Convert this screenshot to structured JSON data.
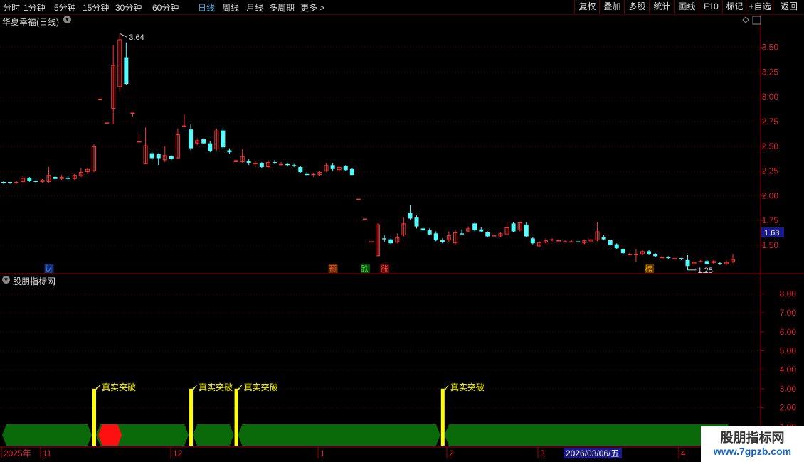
{
  "toolbar": {
    "periods": [
      "分时",
      "1分钟",
      "5分钟",
      "15分钟",
      "30分钟",
      "60分钟",
      "日线",
      "周线",
      "月线",
      "多周期",
      "更多 >"
    ],
    "active_period": "日线",
    "right_buttons": [
      "复权",
      "叠加",
      "多股",
      "统计",
      "画线",
      "F10",
      "标记",
      "+自选",
      "返回"
    ]
  },
  "main_chart": {
    "title": "华夏幸福(日线)",
    "y_ticks": [
      "3.50",
      "3.25",
      "3.00",
      "2.75",
      "2.50",
      "2.25",
      "2.00",
      "1.75",
      "1.50"
    ],
    "price_tag": "1.63",
    "high_label": "3.64",
    "low_label": "1.25",
    "event_markers": [
      {
        "text": "财",
        "color": "#3f8ff0",
        "bg": "#1a2a6a"
      },
      {
        "text": "预",
        "color": "#ff5040",
        "bg": "#5a3000"
      },
      {
        "text": "跌",
        "color": "#40e040",
        "bg": "#0a4a0a"
      },
      {
        "text": "涨",
        "color": "#ff5040",
        "bg": "#5a0a0a"
      },
      {
        "text": "榜",
        "color": "#ffb000",
        "bg": "#5a3a00"
      }
    ]
  },
  "indicator_panel": {
    "title": "股朋指标网",
    "y_ticks": [
      "8.00",
      "7.00",
      "6.00",
      "5.00",
      "4.00",
      "3.00",
      "2.00",
      "1.00"
    ],
    "signal_label": "真实突破",
    "signal_count": 4
  },
  "x_axis": {
    "labels": [
      "2025年",
      "11",
      "12",
      "1",
      "2",
      "3",
      "4"
    ],
    "date_box": "2026/03/06/五"
  },
  "watermark": {
    "line1": "股朋指标网",
    "line2": "www.7gpzb.com"
  },
  "colors": {
    "up": "#ff3232",
    "down": "#54fcfc",
    "axis": "#a00000",
    "band_green": "#0a6a0a",
    "band_red": "#ff1010",
    "signal_bar": "#ffff00",
    "price_tag_bg": "#1a1a8a"
  },
  "chart_data": {
    "type": "candlestick",
    "ylim": [
      1.22,
      3.72
    ],
    "candles": [
      [
        2.14,
        2.13,
        2.15,
        2.12
      ],
      [
        2.14,
        2.13,
        2.14,
        2.12
      ],
      [
        2.13,
        2.14,
        2.15,
        2.12
      ],
      [
        2.14,
        2.18,
        2.2,
        2.13
      ],
      [
        2.18,
        2.15,
        2.19,
        2.14
      ],
      [
        2.15,
        2.14,
        2.16,
        2.13
      ],
      [
        2.14,
        2.16,
        2.17,
        2.13
      ],
      [
        2.14,
        2.21,
        2.29,
        2.13
      ],
      [
        2.19,
        2.17,
        2.22,
        2.16
      ],
      [
        2.17,
        2.19,
        2.21,
        2.16
      ],
      [
        2.18,
        2.17,
        2.2,
        2.16
      ],
      [
        2.17,
        2.21,
        2.22,
        2.16
      ],
      [
        2.2,
        2.24,
        2.28,
        2.19
      ],
      [
        2.24,
        2.27,
        2.28,
        2.22
      ],
      [
        2.25,
        2.5,
        2.52,
        2.24
      ],
      [
        2.98,
        2.98,
        2.98,
        2.98
      ],
      [
        2.74,
        2.74,
        2.74,
        2.74
      ],
      [
        2.88,
        3.32,
        3.52,
        2.72
      ],
      [
        3.1,
        3.58,
        3.64,
        3.05
      ],
      [
        3.4,
        3.13,
        3.55,
        3.12
      ],
      [
        2.84,
        2.84,
        2.84,
        2.8
      ],
      [
        2.55,
        2.55,
        2.62,
        2.55
      ],
      [
        2.32,
        2.51,
        2.69,
        2.32
      ],
      [
        2.43,
        2.38,
        2.44,
        2.36
      ],
      [
        2.42,
        2.38,
        2.43,
        2.31
      ],
      [
        2.36,
        2.41,
        2.5,
        2.34
      ],
      [
        2.4,
        2.37,
        2.41,
        2.36
      ],
      [
        2.38,
        2.62,
        2.68,
        2.37
      ],
      [
        2.7,
        2.71,
        2.82,
        2.69
      ],
      [
        2.67,
        2.48,
        2.72,
        2.46
      ],
      [
        2.53,
        2.56,
        2.58,
        2.51
      ],
      [
        2.57,
        2.53,
        2.58,
        2.52
      ],
      [
        2.53,
        2.45,
        2.55,
        2.44
      ],
      [
        2.47,
        2.66,
        2.68,
        2.46
      ],
      [
        2.66,
        2.49,
        2.69,
        2.47
      ],
      [
        2.46,
        2.44,
        2.48,
        2.42
      ],
      [
        2.34,
        2.36,
        2.36,
        2.33
      ],
      [
        2.34,
        2.4,
        2.47,
        2.33
      ],
      [
        2.35,
        2.33,
        2.37,
        2.31
      ],
      [
        2.33,
        2.33,
        2.35,
        2.29
      ],
      [
        2.33,
        2.29,
        2.34,
        2.28
      ],
      [
        2.29,
        2.34,
        2.36,
        2.28
      ],
      [
        2.34,
        2.33,
        2.36,
        2.32
      ],
      [
        2.32,
        2.32,
        2.34,
        2.31
      ],
      [
        2.32,
        2.31,
        2.33,
        2.3
      ],
      [
        2.31,
        2.3,
        2.32,
        2.29
      ],
      [
        2.29,
        2.24,
        2.3,
        2.23
      ],
      [
        2.22,
        2.21,
        2.24,
        2.2
      ],
      [
        2.21,
        2.22,
        2.23,
        2.19
      ],
      [
        2.21,
        2.24,
        2.25,
        2.2
      ],
      [
        2.25,
        2.31,
        2.33,
        2.24
      ],
      [
        2.31,
        2.27,
        2.33,
        2.25
      ],
      [
        2.26,
        2.29,
        2.31,
        2.24
      ],
      [
        2.3,
        2.26,
        2.31,
        2.25
      ],
      [
        2.27,
        2.21,
        2.28,
        2.21
      ],
      [
        1.97,
        1.97,
        1.97,
        1.97
      ],
      [
        1.77,
        1.77,
        1.77,
        1.77
      ],
      [
        1.54,
        1.54,
        1.54,
        1.54
      ],
      [
        1.39,
        1.71,
        1.72,
        1.39
      ],
      [
        1.57,
        1.56,
        1.6,
        1.53
      ],
      [
        1.56,
        1.52,
        1.57,
        1.51
      ],
      [
        1.53,
        1.58,
        1.62,
        1.52
      ],
      [
        1.6,
        1.72,
        1.78,
        1.59
      ],
      [
        1.83,
        1.77,
        1.91,
        1.76
      ],
      [
        1.78,
        1.69,
        1.8,
        1.67
      ],
      [
        1.67,
        1.65,
        1.69,
        1.64
      ],
      [
        1.65,
        1.61,
        1.67,
        1.6
      ],
      [
        1.62,
        1.55,
        1.64,
        1.54
      ],
      [
        1.55,
        1.53,
        1.57,
        1.52
      ],
      [
        1.55,
        1.6,
        1.64,
        1.53
      ],
      [
        1.52,
        1.63,
        1.65,
        1.51
      ],
      [
        1.62,
        1.61,
        1.66,
        1.6
      ],
      [
        1.64,
        1.67,
        1.69,
        1.63
      ],
      [
        1.72,
        1.65,
        1.73,
        1.64
      ],
      [
        1.66,
        1.64,
        1.68,
        1.63
      ],
      [
        1.63,
        1.59,
        1.64,
        1.58
      ],
      [
        1.6,
        1.6,
        1.61,
        1.59
      ],
      [
        1.59,
        1.62,
        1.63,
        1.58
      ],
      [
        1.61,
        1.68,
        1.73,
        1.6
      ],
      [
        1.72,
        1.64,
        1.73,
        1.63
      ],
      [
        1.65,
        1.73,
        1.74,
        1.64
      ],
      [
        1.71,
        1.59,
        1.73,
        1.58
      ],
      [
        1.57,
        1.52,
        1.58,
        1.51
      ],
      [
        1.49,
        1.53,
        1.54,
        1.48
      ],
      [
        1.53,
        1.55,
        1.57,
        1.52
      ],
      [
        1.55,
        1.56,
        1.57,
        1.54
      ],
      [
        1.55,
        1.55,
        1.56,
        1.54
      ],
      [
        1.54,
        1.54,
        1.55,
        1.54
      ],
      [
        1.54,
        1.54,
        1.55,
        1.53
      ],
      [
        1.54,
        1.53,
        1.54,
        1.53
      ],
      [
        1.52,
        1.55,
        1.56,
        1.51
      ],
      [
        1.54,
        1.56,
        1.57,
        1.53
      ],
      [
        1.55,
        1.64,
        1.73,
        1.54
      ],
      [
        1.58,
        1.56,
        1.6,
        1.55
      ],
      [
        1.55,
        1.5,
        1.56,
        1.49
      ],
      [
        1.51,
        1.47,
        1.52,
        1.46
      ],
      [
        1.46,
        1.42,
        1.47,
        1.41
      ],
      [
        1.41,
        1.41,
        1.42,
        1.4
      ],
      [
        1.41,
        1.41,
        1.46,
        1.33
      ],
      [
        1.41,
        1.44,
        1.45,
        1.4
      ],
      [
        1.44,
        1.41,
        1.45,
        1.4
      ],
      [
        1.41,
        1.39,
        1.42,
        1.38
      ],
      [
        1.38,
        1.38,
        1.39,
        1.37
      ],
      [
        1.38,
        1.37,
        1.39,
        1.36
      ],
      [
        1.37,
        1.37,
        1.38,
        1.36
      ],
      [
        1.37,
        1.36,
        1.37,
        1.35
      ],
      [
        1.35,
        1.29,
        1.4,
        1.25
      ],
      [
        1.31,
        1.33,
        1.34,
        1.3
      ],
      [
        1.34,
        1.34,
        1.35,
        1.33
      ],
      [
        1.34,
        1.31,
        1.35,
        1.3
      ],
      [
        1.32,
        1.34,
        1.35,
        1.31
      ],
      [
        1.32,
        1.31,
        1.33,
        1.3
      ],
      [
        1.31,
        1.33,
        1.35,
        1.3
      ],
      [
        1.33,
        1.36,
        1.41,
        1.32
      ]
    ],
    "signal_candles": [
      14,
      29,
      36,
      68
    ],
    "signal_value": 3.0,
    "red_band_candles": [
      15,
      16,
      17,
      18
    ]
  }
}
